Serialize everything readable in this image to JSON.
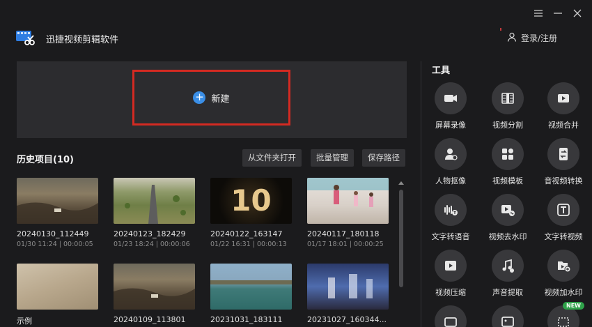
{
  "app": {
    "title": "迅捷视频剪辑软件"
  },
  "header": {
    "login_label": "登录/注册"
  },
  "new_project": {
    "label": "新建"
  },
  "history": {
    "title": "历史项目(10)",
    "buttons": {
      "open_folder": "从文件夹打开",
      "batch_manage": "批量管理",
      "save_path": "保存路径"
    },
    "items": [
      {
        "name": "20240130_112449",
        "meta": "01/30 11:24 | 00:00:05"
      },
      {
        "name": "20240123_182429",
        "meta": "01/23 18:24 | 00:00:06"
      },
      {
        "name": "20240122_163147",
        "meta": "01/22 16:31 | 00:00:13",
        "thumb_text": "10"
      },
      {
        "name": "20240117_180118",
        "meta": "01/17 18:01 | 00:00:25"
      },
      {
        "name": "示例",
        "meta": ""
      },
      {
        "name": "20240109_113801",
        "meta": ""
      },
      {
        "name": "20231031_183111",
        "meta": ""
      },
      {
        "name": "20231027_160344...",
        "meta": ""
      }
    ]
  },
  "tools": {
    "title": "工具",
    "new_badge": "NEW",
    "items": [
      {
        "label": "屏幕录像",
        "icon": "camera-icon"
      },
      {
        "label": "视频分割",
        "icon": "film-split-icon"
      },
      {
        "label": "视频合并",
        "icon": "video-merge-icon"
      },
      {
        "label": "人物抠像",
        "icon": "person-cutout-icon"
      },
      {
        "label": "视频模板",
        "icon": "template-icon"
      },
      {
        "label": "音视频转换",
        "icon": "convert-icon"
      },
      {
        "label": "文字转语音",
        "icon": "text-to-speech-icon"
      },
      {
        "label": "视频去水印",
        "icon": "remove-watermark-icon"
      },
      {
        "label": "文字转视频",
        "icon": "text-to-video-icon"
      },
      {
        "label": "视频压缩",
        "icon": "compress-icon"
      },
      {
        "label": "声音提取",
        "icon": "audio-extract-icon"
      },
      {
        "label": "视频加水印",
        "icon": "add-watermark-icon"
      },
      {
        "label": "",
        "icon": "video-tool-icon"
      },
      {
        "label": "",
        "icon": "image-tool-icon"
      },
      {
        "label": "",
        "icon": "crop-tool-icon"
      }
    ]
  },
  "colors": {
    "accent": "#3a8ee6",
    "highlight_border": "#d42a22",
    "badge": "#2fa24a"
  }
}
